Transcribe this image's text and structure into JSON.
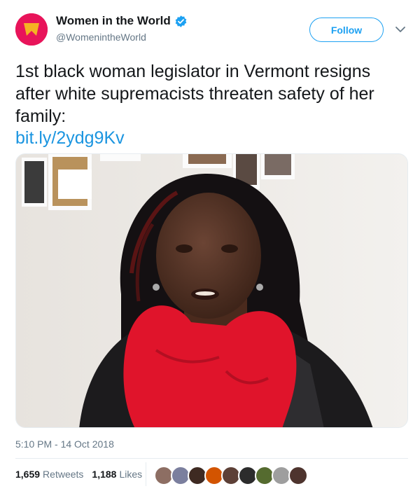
{
  "account": {
    "display_name": "Women in the World",
    "handle": "@WomenintheWorld",
    "verified": true,
    "avatar_color": "#e8145a"
  },
  "follow_button": {
    "label": "Follow"
  },
  "tweet": {
    "text": "1st black woman legislator in Vermont resigns after white supremacists threaten safety of her family:",
    "link": "bit.ly/2ydg9Kv",
    "timestamp": "5:10 PM - 14 Oct 2018"
  },
  "stats": {
    "retweets": {
      "count": "1,659",
      "label": "Retweets"
    },
    "likes": {
      "count": "1,188",
      "label": "Likes"
    }
  },
  "liker_avatars": [
    "#8d6e63",
    "#7b7f9e",
    "#3e2a22",
    "#d35400",
    "#5d4037",
    "#2c2c2c",
    "#556b2f",
    "#9e9e9e",
    "#4e342e"
  ],
  "colors": {
    "link": "#1b95e0",
    "follow": "#1da1f2",
    "scarf": "#e0142b"
  }
}
